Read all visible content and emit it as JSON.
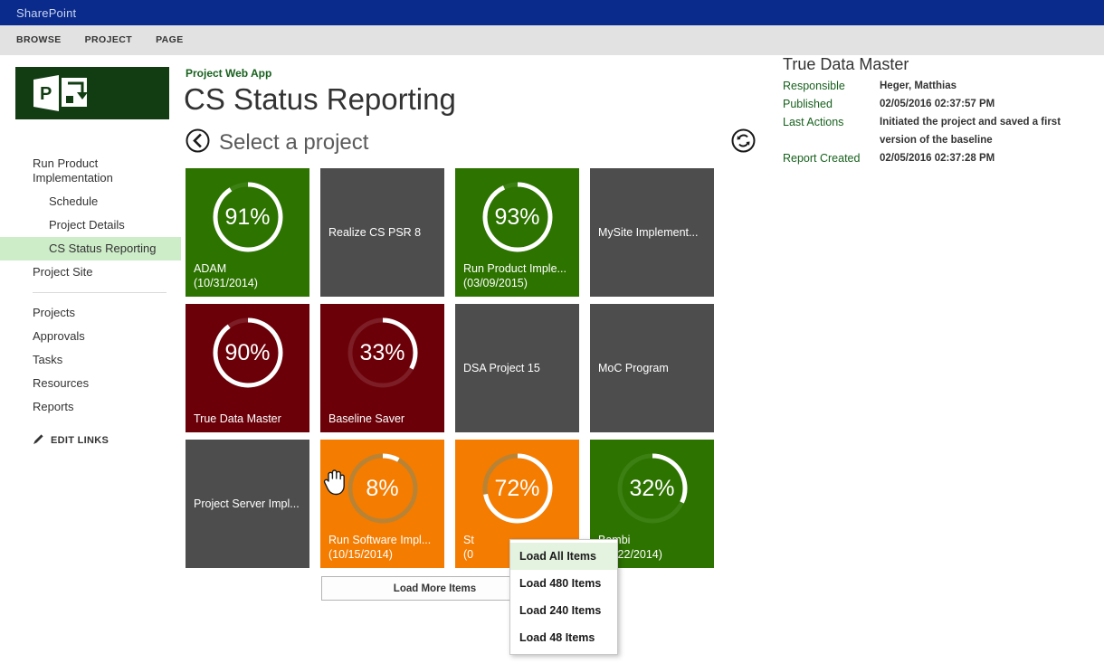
{
  "suitebar": {
    "brand": "SharePoint"
  },
  "ribbon": {
    "tabs": [
      {
        "label": "BROWSE"
      },
      {
        "label": "PROJECT"
      },
      {
        "label": "PAGE"
      }
    ]
  },
  "sidebar": {
    "logo_icon": "project-logo-icon",
    "items": [
      {
        "label": "Run Product Implementation",
        "level": 1,
        "selected": false
      },
      {
        "label": "Schedule",
        "level": 2,
        "selected": false
      },
      {
        "label": "Project Details",
        "level": 2,
        "selected": false
      },
      {
        "label": "CS Status Reporting",
        "level": 2,
        "selected": true
      },
      {
        "label": "Project Site",
        "level": 1,
        "selected": false
      }
    ],
    "items2": [
      {
        "label": "Projects"
      },
      {
        "label": "Approvals"
      },
      {
        "label": "Tasks"
      },
      {
        "label": "Resources"
      },
      {
        "label": "Reports"
      }
    ],
    "edit_links": "EDIT LINKS"
  },
  "header": {
    "eyebrow": "Project Web App",
    "title": "CS Status Reporting"
  },
  "selectbar": {
    "back_icon": "back-circle-icon",
    "title": "Select a project",
    "refresh_icon": "refresh-circle-icon"
  },
  "tiles": [
    {
      "name": "ADAM",
      "date": "(10/31/2014)",
      "percent": 91,
      "color": "#2d7300",
      "track": "#3c7f13",
      "has_ring": true
    },
    {
      "name": "Realize CS PSR 8",
      "date": "",
      "percent": null,
      "color": "#4d4d4d",
      "track": "#4d4d4d",
      "has_ring": false
    },
    {
      "name": "Run Product Imple...",
      "date": "(03/09/2015)",
      "percent": 93,
      "color": "#2d7300",
      "track": "#3c7f13",
      "has_ring": true
    },
    {
      "name": "MySite Implement...",
      "date": "",
      "percent": null,
      "color": "#4d4d4d",
      "track": "#4d4d4d",
      "has_ring": false
    },
    {
      "name": "True Data Master",
      "date": "",
      "percent": 90,
      "color": "#6b0008",
      "track": "#7d1d25",
      "has_ring": true
    },
    {
      "name": "Baseline Saver",
      "date": "",
      "percent": 33,
      "color": "#6b0008",
      "track": "#7d1d25",
      "has_ring": true
    },
    {
      "name": "DSA Project 15",
      "date": "",
      "percent": null,
      "color": "#4d4d4d",
      "track": "#4d4d4d",
      "has_ring": false
    },
    {
      "name": "MoC Program",
      "date": "",
      "percent": null,
      "color": "#4d4d4d",
      "track": "#4d4d4d",
      "has_ring": false
    },
    {
      "name": "Project Server Impl...",
      "date": "",
      "percent": null,
      "color": "#4d4d4d",
      "track": "#4d4d4d",
      "has_ring": false
    },
    {
      "name": "Run Software Impl...",
      "date": "(10/15/2014)",
      "percent": 8,
      "color": "#f47c00",
      "track": "#b98335",
      "has_ring": true
    },
    {
      "name": "St",
      "date": "(0",
      "percent": 72,
      "color": "#f47c00",
      "track": "#b98335",
      "has_ring": true
    },
    {
      "name": "Bambi",
      "date": "(10/22/2014)",
      "percent": 32,
      "color": "#2d7300",
      "track": "#3c7f13",
      "has_ring": true
    }
  ],
  "load_more": {
    "label": "Load More Items",
    "arrow_icon": "chevron-down-icon"
  },
  "dropdown": {
    "items": [
      {
        "label": "Load All Items",
        "selected": true
      },
      {
        "label": "Load 480 Items",
        "selected": false
      },
      {
        "label": "Load 240 Items",
        "selected": false
      },
      {
        "label": "Load 48 Items",
        "selected": false
      }
    ]
  },
  "detail": {
    "title": "True Data Master",
    "rows": [
      {
        "key": "Responsible",
        "value": "Heger, Matthias"
      },
      {
        "key": "Published",
        "value": "02/05/2016 02:37:57 PM"
      },
      {
        "key": "Last Actions",
        "value": "Initiated the project and saved a first version of the baseline"
      },
      {
        "key": "Report Created",
        "value": "02/05/2016 02:37:28 PM"
      }
    ]
  }
}
